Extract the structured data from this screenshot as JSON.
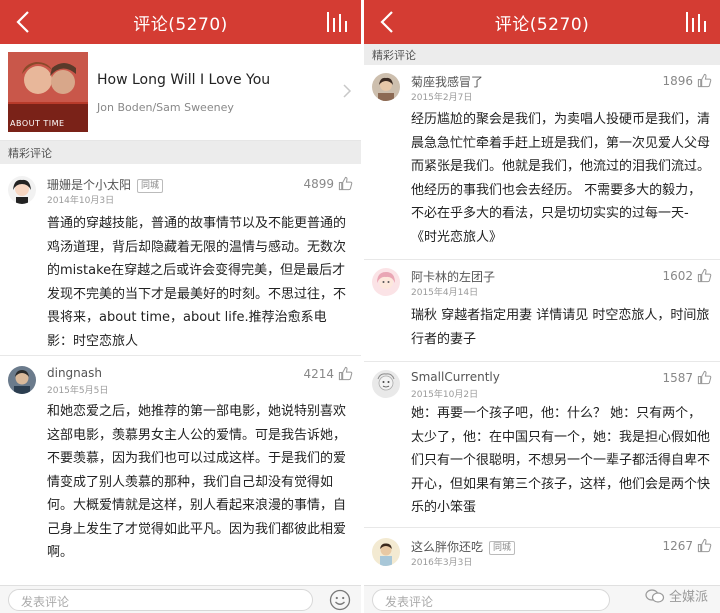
{
  "left": {
    "header": {
      "title": "评论(5270)"
    },
    "song": {
      "title": "How Long Will I Love You",
      "artist": "Jon Boden/Sam Sweeney",
      "cover_text": "ABOUT TIME"
    },
    "section_label": "精彩评论",
    "comments": [
      {
        "name": "珊姗是个小太阳",
        "tag": "同城",
        "date": "2014年10月3日",
        "likes": "4899",
        "text": "普通的穿越技能，普通的故事情节以及不能更普通的鸡汤道理，背后却隐藏着无限的温情与感动。无数次的mistake在穿越之后或许会变得完美，但是最后才发现不完美的当下才是最美好的时刻。不思过往，不畏将来，about time，about life.推荐治愈系电影：时空恋旅人"
      },
      {
        "name": "dingnash",
        "date": "2015年5月5日",
        "likes": "4214",
        "text": "和她恋爱之后，她推荐的第一部电影，她说特别喜欢这部电影，羡慕男女主人公的爱情。可是我告诉她，不要羡慕，因为我们也可以过成这样。于是我们的爱情变成了别人羡慕的那种，我们自己却没有觉得如何。大概爱情就是这样，别人看起来浪漫的事情，自己身上发生了才觉得如此平凡。因为我们都彼此相爱啊。"
      }
    ],
    "input_placeholder": "发表评论"
  },
  "right": {
    "header": {
      "title": "评论(5270)"
    },
    "section_label": "精彩评论",
    "comments": [
      {
        "name": "菊座我感冒了",
        "date": "2015年2月7日",
        "likes": "1896",
        "text": "经历尴尬的聚会是我们，为卖唱人投硬币是我们，清晨急急忙忙牵着手赶上班是我们，第一次见爱人父母而紧张是我们。他就是我们，他流过的泪我们流过。他经历的事我们也会去经历。 不需要多大的毅力，不必在乎多大的看法，只是切切实实的过每一天-《时光恋旅人》"
      },
      {
        "name": "阿卡林的左团子",
        "date": "2015年4月14日",
        "likes": "1602",
        "text": "瑞秋 穿越者指定用妻 详情请见 时空恋旅人，时间旅行者的妻子"
      },
      {
        "name": "SmallCurrently",
        "date": "2015年10月2日",
        "likes": "1587",
        "text": "她：再要一个孩子吧，他：什么？ 她：只有两个，太少了，他：在中国只有一个，她：我是担心假如他们只有一个很聪明，不想另一个一辈子都活得自卑不开心，但如果有第三个孩子，这样，他们会是两个快乐的小笨蛋"
      },
      {
        "name": "这么胖你还吃",
        "tag": "同城",
        "date": "2016年3月3日",
        "likes": "1267",
        "text": ""
      }
    ],
    "input_placeholder": "发表评论",
    "watermark": "全媒派"
  },
  "colors": {
    "accent": "#d43c33",
    "section_bg": "#ececec"
  },
  "icons": [
    "back-arrow-icon",
    "bars-icon",
    "chevron-right-icon",
    "thumb-up-icon",
    "emoji-icon"
  ]
}
